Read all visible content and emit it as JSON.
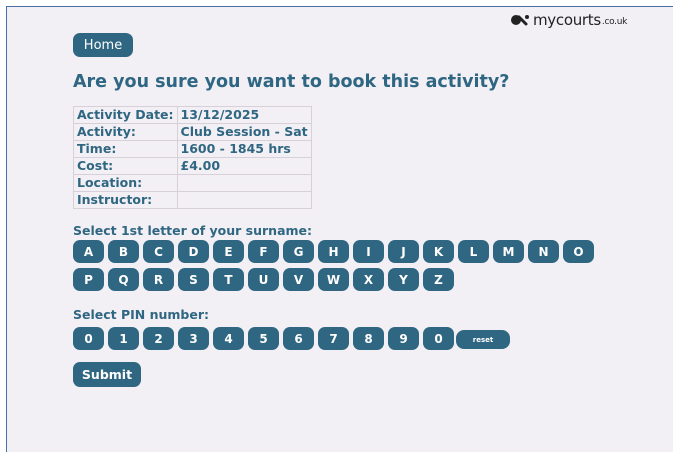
{
  "logo": {
    "main": "mycourts",
    "suffix": ".co.uk"
  },
  "nav": {
    "home_label": "Home"
  },
  "page": {
    "title": "Are you sure you want to book this activity?"
  },
  "details": [
    {
      "label": "Activity Date:",
      "value": "13/12/2025"
    },
    {
      "label": "Activity:",
      "value": "Club Session - Sat"
    },
    {
      "label": "Time:",
      "value": "1600 - 1845 hrs"
    },
    {
      "label": "Cost:",
      "value": "£4.00"
    },
    {
      "label": "Location:",
      "value": ""
    },
    {
      "label": "Instructor:",
      "value": ""
    }
  ],
  "surname": {
    "label": "Select 1st letter of your surname:",
    "letters": [
      "A",
      "B",
      "C",
      "D",
      "E",
      "F",
      "G",
      "H",
      "I",
      "J",
      "K",
      "L",
      "M",
      "N",
      "O",
      "P",
      "Q",
      "R",
      "S",
      "T",
      "U",
      "V",
      "W",
      "X",
      "Y",
      "Z"
    ]
  },
  "pin": {
    "label": "Select PIN number:",
    "digits": [
      "0",
      "1",
      "2",
      "3",
      "4",
      "5",
      "6",
      "7",
      "8",
      "9",
      "0"
    ],
    "reset_label": "reset"
  },
  "actions": {
    "submit_label": "Submit"
  },
  "colors": {
    "accent": "#2f6682",
    "background": "#f3f0f5"
  }
}
